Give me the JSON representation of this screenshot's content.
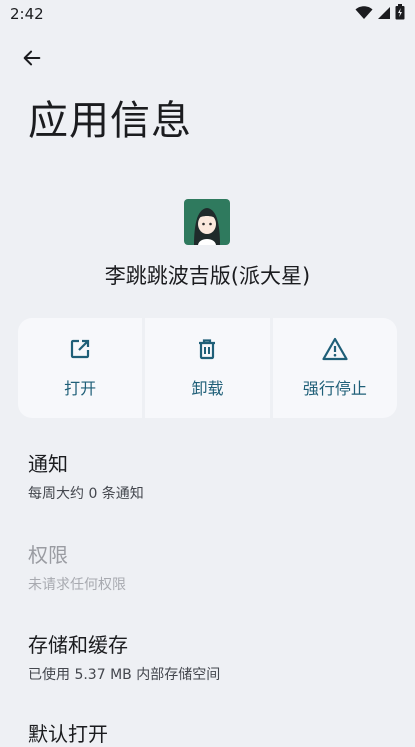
{
  "status_bar": {
    "time": "2:42"
  },
  "header": {
    "title": "应用信息"
  },
  "app": {
    "name": "李跳跳波吉版(派大星)"
  },
  "actions": [
    {
      "label": "打开",
      "icon": "open-external-icon"
    },
    {
      "label": "卸载",
      "icon": "trash-icon"
    },
    {
      "label": "强行停止",
      "icon": "warning-icon"
    }
  ],
  "list": [
    {
      "title": "通知",
      "subtitle": "每周大约 0 条通知",
      "enabled": true
    },
    {
      "title": "权限",
      "subtitle": "未请求任何权限",
      "enabled": false
    },
    {
      "title": "存储和缓存",
      "subtitle": "已使用 5.37 MB 内部存储空间",
      "enabled": true
    },
    {
      "title": "默认打开",
      "subtitle": "",
      "enabled": true
    }
  ],
  "colors": {
    "accent": "#1f5f78",
    "background": "#eef0f4",
    "card": "#f7f8fb"
  }
}
